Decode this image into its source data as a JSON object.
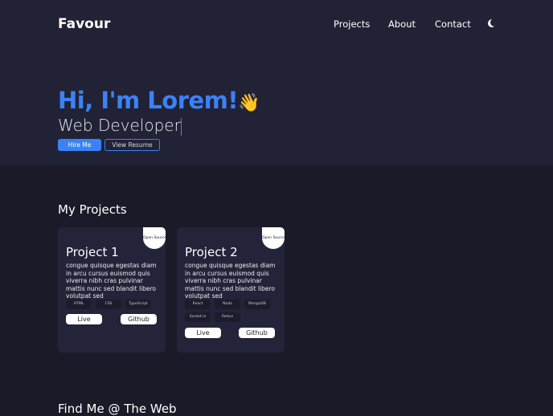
{
  "header": {
    "logo": "Favour",
    "nav": [
      "Projects",
      "About",
      "Contact"
    ],
    "theme_icon": "moon-icon"
  },
  "hero": {
    "greeting": "Hi, I'm Lorem!",
    "emoji": "👋",
    "role": "Web Developer",
    "hire": "Hire Me",
    "resume": "View Resume"
  },
  "projects": {
    "title": "My Projects",
    "items": [
      {
        "badge": "Open Source",
        "title": "Project 1",
        "desc": "congue quisque egestas diam in arcu cursus euismod quis viverra nibh cras pulvinar mattis nunc sed blandit libero volutpat sed",
        "tags": [
          "HTML",
          "CSS",
          "TypeScript"
        ],
        "live": "Live",
        "github": "Github"
      },
      {
        "badge": "Open Source",
        "title": "Project 2",
        "desc": "congue quisque egestas diam in arcu cursus euismod quis viverra nibh cras pulvinar mattis nunc sed blandit libero volutpat sed",
        "tags": [
          "React",
          "Node",
          "MongoDB",
          "Socket.io",
          "Redux"
        ],
        "live": "Live",
        "github": "Github"
      }
    ]
  },
  "find": {
    "title": "Find Me @ The Web"
  },
  "colors": {
    "accent": "#3b82f6",
    "hero_bg": "#222236",
    "page_bg": "#1a1a28",
    "card_bg": "#23233a"
  }
}
